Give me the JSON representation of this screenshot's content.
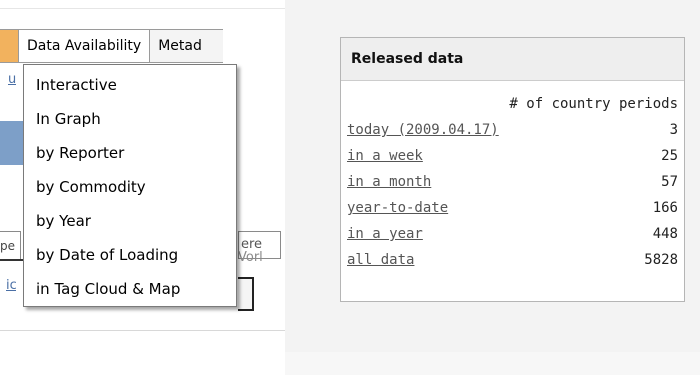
{
  "menubar": {
    "tabs": [
      {
        "label": "Data Availability",
        "active": true
      },
      {
        "label": "Metadata",
        "visible_text": "Metad"
      }
    ]
  },
  "dropdown": {
    "items": [
      "Interactive",
      "In Graph",
      "by Reporter",
      "by Commodity",
      "by Year",
      "by Date of Loading",
      "in Tag Cloud & Map"
    ]
  },
  "background_fragments": {
    "field_right_text": "ere",
    "link_right_text": "Vorl",
    "field_left_text": "pe",
    "link_top_left": "ut",
    "link_bottom_left": "ic"
  },
  "released_data": {
    "title": "Released data",
    "column_header": "# of country periods",
    "rows": [
      {
        "label": "today (2009.04.17)",
        "count": "3"
      },
      {
        "label": "in a week",
        "count": "25"
      },
      {
        "label": "in a month",
        "count": "57"
      },
      {
        "label": "year-to-date",
        "count": "166"
      },
      {
        "label": "in a year",
        "count": "448"
      },
      {
        "label": "all data",
        "count": "5828"
      }
    ]
  },
  "colors": {
    "active_tab_accent": "#f2b25e",
    "blue_band": "#7d9fc8",
    "link": "#555555"
  }
}
